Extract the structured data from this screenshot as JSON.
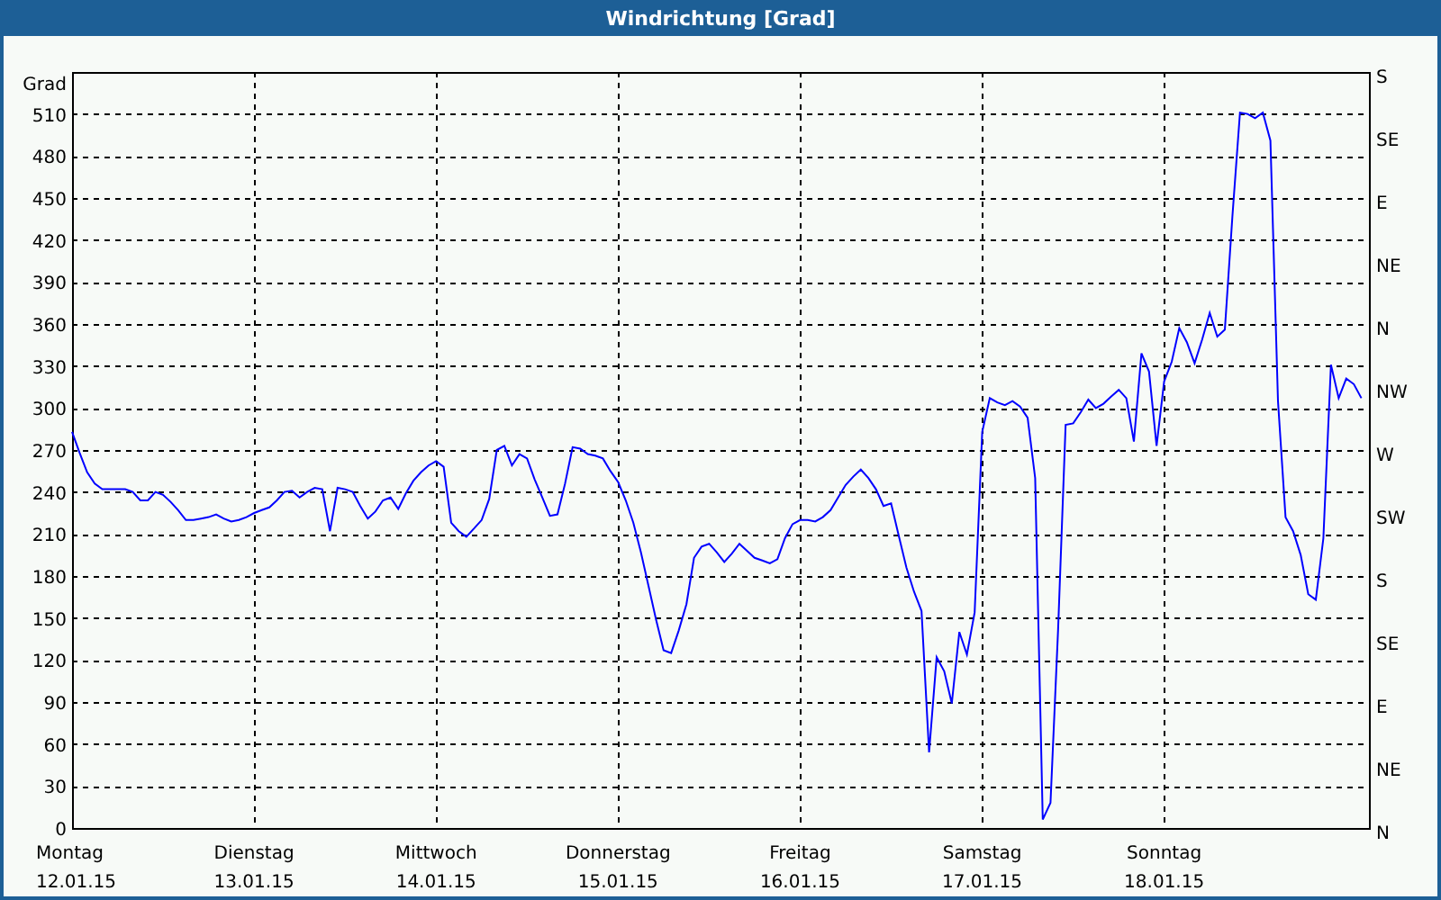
{
  "window": {
    "title": "Windrichtung [Grad]"
  },
  "chart": {
    "right_axis_labels": [
      "S",
      "SE",
      "E",
      "NE",
      "N",
      "NW",
      "W",
      "SW",
      "S",
      "SE",
      "E",
      "NE",
      "N"
    ],
    "date_labels": [
      "12.01.15",
      "13.01.15",
      "14.01.15",
      "15.01.15",
      "16.01.15",
      "17.01.15",
      "18.01.15"
    ],
    "chart_data": {
      "type": "line",
      "ylabel": "Grad",
      "ylim": [
        0,
        540
      ],
      "grid": true,
      "yticks": [
        0,
        30,
        60,
        90,
        120,
        150,
        180,
        210,
        240,
        270,
        300,
        330,
        360,
        390,
        420,
        450,
        480,
        510
      ],
      "categories": [
        "Montag",
        null,
        null,
        null,
        null,
        null,
        null,
        null,
        null,
        null,
        null,
        null,
        null,
        null,
        null,
        null,
        null,
        null,
        null,
        null,
        null,
        null,
        null,
        null,
        "Dienstag",
        null,
        null,
        null,
        null,
        null,
        null,
        null,
        null,
        null,
        null,
        null,
        null,
        null,
        null,
        null,
        null,
        null,
        null,
        null,
        null,
        null,
        null,
        null,
        "Mittwoch",
        null,
        null,
        null,
        null,
        null,
        null,
        null,
        null,
        null,
        null,
        null,
        null,
        null,
        null,
        null,
        null,
        null,
        null,
        null,
        null,
        null,
        null,
        null,
        "Donnerstag",
        null,
        null,
        null,
        null,
        null,
        null,
        null,
        null,
        null,
        null,
        null,
        null,
        null,
        null,
        null,
        null,
        null,
        null,
        null,
        null,
        null,
        null,
        null,
        "Freitag",
        null,
        null,
        null,
        null,
        null,
        null,
        null,
        null,
        null,
        null,
        null,
        null,
        null,
        null,
        null,
        null,
        null,
        null,
        null,
        null,
        null,
        null,
        null,
        "Samstag",
        null,
        null,
        null,
        null,
        null,
        null,
        null,
        null,
        null,
        null,
        null,
        null,
        null,
        null,
        null,
        null,
        null,
        null,
        null,
        null,
        null,
        null,
        null,
        "Sonntag",
        null,
        null,
        null,
        null,
        null,
        null,
        null,
        null,
        null,
        null,
        null,
        null,
        null,
        null,
        null,
        null,
        null,
        null,
        null,
        null,
        null,
        null,
        null,
        null,
        null,
        null
      ],
      "series": [
        {
          "color": "#0000ff",
          "values": [
            283,
            268,
            254,
            246,
            242,
            242,
            242,
            242,
            240,
            234,
            234,
            240,
            238,
            233,
            227,
            220,
            220,
            221,
            222,
            224,
            221,
            219,
            220,
            222,
            225,
            227,
            229,
            234,
            240,
            241,
            236,
            240,
            243,
            242,
            212,
            243,
            242,
            240,
            230,
            221,
            226,
            234,
            236,
            228,
            239,
            248,
            254,
            259,
            262,
            258,
            218,
            212,
            208,
            214,
            220,
            235,
            270,
            273,
            259,
            267,
            264,
            249,
            236,
            223,
            224,
            246,
            272,
            271,
            267,
            266,
            264,
            255,
            247,
            234,
            218,
            197,
            173,
            149,
            127,
            125,
            141,
            160,
            193,
            201,
            203,
            197,
            190,
            196,
            203,
            198,
            193,
            191,
            189,
            192,
            207,
            217,
            220,
            220,
            219,
            222,
            227,
            236,
            245,
            251,
            256,
            250,
            242,
            230,
            232,
            209,
            186,
            169,
            155,
            54,
            122,
            112,
            89,
            140,
            124,
            154,
            283,
            307,
            304,
            302,
            305,
            301,
            293,
            250,
            6,
            18,
            141,
            288,
            289,
            297,
            306,
            300,
            303,
            308,
            313,
            307,
            276,
            339,
            326,
            273,
            319,
            333,
            357,
            347,
            332,
            349,
            368,
            351,
            356,
            437,
            511,
            510,
            507,
            511,
            491,
            305,
            222,
            212,
            195,
            167,
            163,
            207,
            331,
            307,
            321,
            317,
            307
          ]
        }
      ]
    }
  }
}
